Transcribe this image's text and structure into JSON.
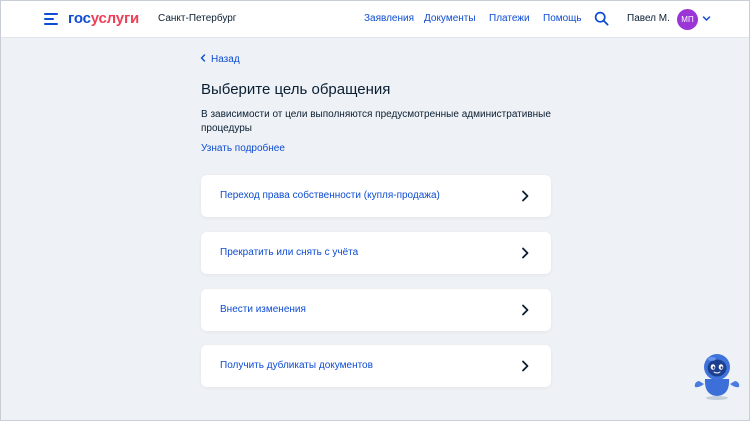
{
  "header": {
    "logo_part1": "гос",
    "logo_part2": "услуги",
    "city": "Санкт-Петербург",
    "nav": [
      "Заявления",
      "Документы",
      "Платежи",
      "Помощь"
    ],
    "user_name": "Павел М.",
    "avatar_initials": "МП"
  },
  "main": {
    "back_label": "Назад",
    "title": "Выберите цель обращения",
    "description": "В зависимости от цели выполняются предусмотренные административные процедуры",
    "more_link": "Узнать подробнее",
    "options": [
      "Переход права собственности (купля-продажа)",
      "Прекратить или снять с учёта",
      "Внести изменения",
      "Получить дубликаты документов"
    ]
  },
  "icons": {
    "menu": "burger-menu-icon",
    "search": "search-icon",
    "dropdown": "chevron-down-icon",
    "back": "chevron-left-icon",
    "option_arrow": "chevron-right-icon",
    "assistant": "robot-assistant-icon"
  },
  "colors": {
    "primary": "#0d4cd3",
    "brand_red": "#ee3f58",
    "background": "#eef1f5",
    "avatar": "#9b35d8",
    "text": "#0b1f33"
  }
}
